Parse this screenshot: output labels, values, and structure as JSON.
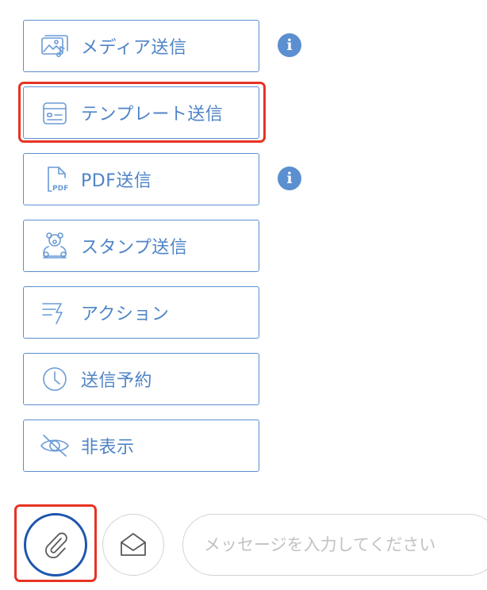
{
  "menu": {
    "items": [
      {
        "id": "media",
        "label": "メディア送信",
        "icon": "media-icon"
      },
      {
        "id": "template",
        "label": "テンプレート送信",
        "icon": "template-icon"
      },
      {
        "id": "pdf",
        "label": "PDF送信",
        "icon": "pdf-icon"
      },
      {
        "id": "stamp",
        "label": "スタンプ送信",
        "icon": "bear-stamp-icon"
      },
      {
        "id": "action",
        "label": "アクション",
        "icon": "action-icon"
      },
      {
        "id": "schedule",
        "label": "送信予約",
        "icon": "clock-icon"
      },
      {
        "id": "hide",
        "label": "非表示",
        "icon": "eye-slash-icon"
      }
    ],
    "info_glyph": "i"
  },
  "composer": {
    "attach_icon": "paperclip-icon",
    "template_icon": "envelope-open-icon",
    "placeholder": "メッセージを入力してください",
    "value": ""
  },
  "colors": {
    "accent": "#5b8fd0",
    "highlight": "#e63323",
    "attach_ring": "#1e55ad"
  }
}
